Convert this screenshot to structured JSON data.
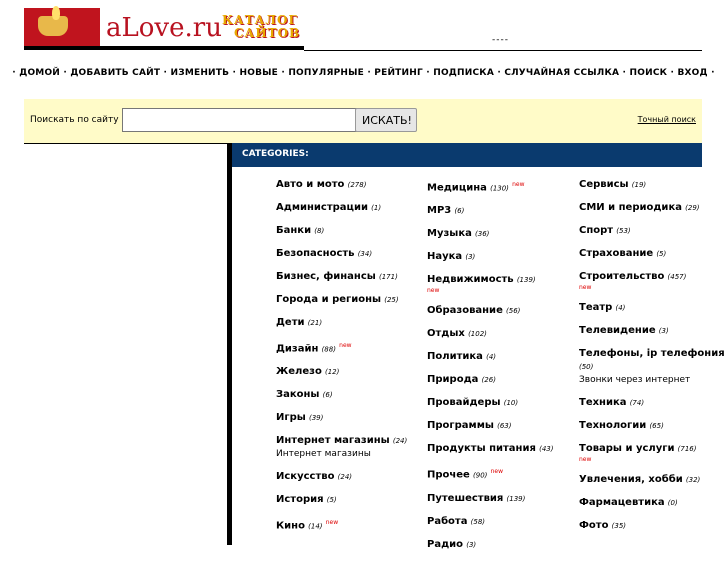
{
  "header": {
    "logo_text": "aLove.ru",
    "catalog_line1": "КАТАЛОГ",
    "catalog_line2": "САЙТОВ",
    "dashes": "----"
  },
  "nav": [
    "ДОМОЙ",
    "ДОБАВИТЬ САЙТ",
    "ИЗМЕНИТЬ",
    "НОВЫЕ",
    "ПОПУЛЯРНЫЕ",
    "РЕЙТИНГ",
    "ПОДПИСКА",
    "СЛУЧАЙНАЯ ССЫЛКА",
    "ПОИСК",
    "ВХОД"
  ],
  "search": {
    "label": "Поискать по сайту",
    "value": "",
    "button": "ИСКАТЬ!",
    "exact_link": "Точный поиск"
  },
  "categories_title": "CATEGORIES:",
  "new_label": "new",
  "columns": [
    [
      {
        "name": "Авто и мото",
        "count": "(278)"
      },
      {
        "name": "Администрации",
        "count": "(1)"
      },
      {
        "name": "Банки",
        "count": "(8)"
      },
      {
        "name": "Безопасность",
        "count": "(34)"
      },
      {
        "name": "Бизнес, финансы",
        "count": "(171)"
      },
      {
        "name": "Города и регионы",
        "count": "(25)"
      },
      {
        "name": "Дети",
        "count": "(21)"
      },
      {
        "name": "Дизайн",
        "count": "(88)",
        "new": true
      },
      {
        "name": "Железо",
        "count": "(12)"
      },
      {
        "name": "Законы",
        "count": "(6)"
      },
      {
        "name": "Игры",
        "count": "(39)"
      },
      {
        "name": "Интернет магазины",
        "count": "(24)",
        "sub": "Интернет магазины"
      },
      {
        "name": "Искусство",
        "count": "(24)"
      },
      {
        "name": "История",
        "count": "(5)"
      },
      {
        "name": "Кино",
        "count": "(14)",
        "new": true
      }
    ],
    [
      {
        "name": "Медицина",
        "count": "(130)",
        "new": true
      },
      {
        "name": "MP3",
        "count": "(6)"
      },
      {
        "name": "Музыка",
        "count": "(36)"
      },
      {
        "name": "Наука",
        "count": "(3)"
      },
      {
        "name": "Недвижимость",
        "count": "(139)",
        "new": true,
        "new_block": true
      },
      {
        "name": "Образование",
        "count": "(56)"
      },
      {
        "name": "Отдых",
        "count": "(102)"
      },
      {
        "name": "Политика",
        "count": "(4)"
      },
      {
        "name": "Природа",
        "count": "(26)"
      },
      {
        "name": "Провайдеры",
        "count": "(10)"
      },
      {
        "name": "Программы",
        "count": "(63)"
      },
      {
        "name": "Продукты питания",
        "count": "(43)"
      },
      {
        "name": "Прочее",
        "count": "(90)",
        "new": true
      },
      {
        "name": "Путешествия",
        "count": "(139)"
      },
      {
        "name": "Работа",
        "count": "(58)"
      },
      {
        "name": "Радио",
        "count": "(3)"
      }
    ],
    [
      {
        "name": "Сервисы",
        "count": "(19)"
      },
      {
        "name": "СМИ и периодика",
        "count": "(29)"
      },
      {
        "name": "Спорт",
        "count": "(53)"
      },
      {
        "name": "Страхование",
        "count": "(5)"
      },
      {
        "name": "Строительство",
        "count": "(457)",
        "new": true,
        "new_block": true
      },
      {
        "name": "Театр",
        "count": "(4)"
      },
      {
        "name": "Телевидение",
        "count": "(3)"
      },
      {
        "name": "Телефоны, ip телефония",
        "count": "(50)",
        "sub": "Звонки через интернет"
      },
      {
        "name": "Техника",
        "count": "(74)"
      },
      {
        "name": "Технологии",
        "count": "(65)"
      },
      {
        "name": "Товары и услуги",
        "count": "(716)",
        "new": true,
        "new_block": true
      },
      {
        "name": "Увлечения, хобби",
        "count": "(32)"
      },
      {
        "name": "Фармацевтика",
        "count": "(0)"
      },
      {
        "name": "Фото",
        "count": "(35)"
      }
    ]
  ]
}
